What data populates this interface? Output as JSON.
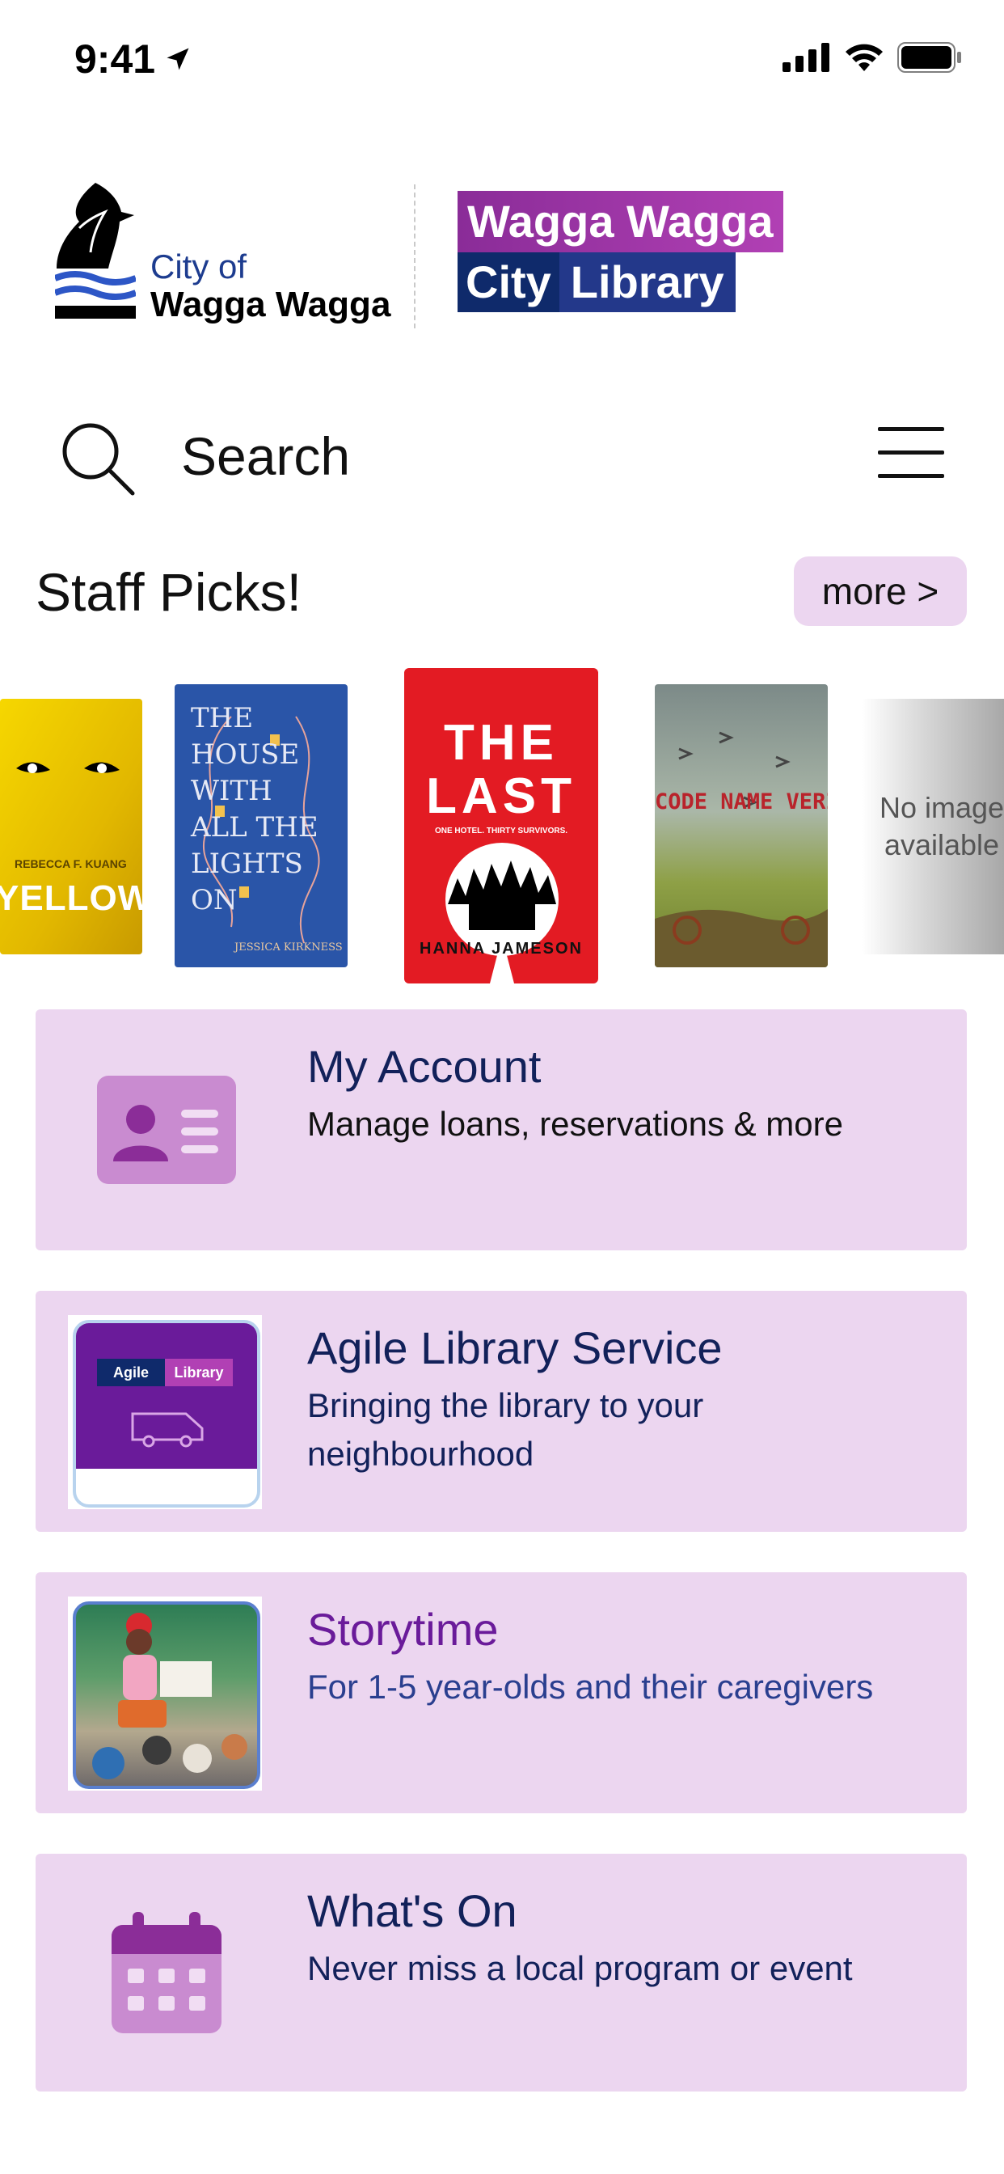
{
  "status_bar": {
    "time": "9:41"
  },
  "header": {
    "council_line1": "City of",
    "council_line2": "Wagga Wagga",
    "library_line1": "Wagga Wagga",
    "library_line2a": "City",
    "library_line2b": "Library"
  },
  "search": {
    "label": "Search"
  },
  "staff_picks": {
    "title": "Staff Picks!",
    "more_label": "more >",
    "books": [
      {
        "cover_text": "YELLOWFACE",
        "author": "REBECCA F. KUANG"
      },
      {
        "cover_text": "THE HOUSE WITH ALL THE LIGHTS ON",
        "author": "JESSICA KIRKNESS"
      },
      {
        "cover_text": "THE LAST",
        "tagline": "ONE HOTEL. THIRTY SURVIVORS.",
        "author": "HANNA JAMESON"
      },
      {
        "cover_text": "CODE NAME VERITY"
      },
      {
        "no_image": "No image available"
      }
    ]
  },
  "cards": [
    {
      "title": "My Account",
      "subtitle": "Manage loans, reservations & more",
      "icon": "account-card-icon"
    },
    {
      "title": "Agile Library Service",
      "subtitle": "Bringing the library to your neighbourhood",
      "thumb_label_a": "Agile",
      "thumb_label_b": "Library"
    },
    {
      "title": "Storytime",
      "subtitle": "For 1-5 year-olds and their caregivers"
    },
    {
      "title": "What's On",
      "subtitle": "Never miss a local program or event",
      "icon": "calendar-icon"
    }
  ],
  "colors": {
    "card_bg": "#ecd6f0",
    "accent_purple": "#6a1b9a",
    "navy": "#12215a"
  }
}
